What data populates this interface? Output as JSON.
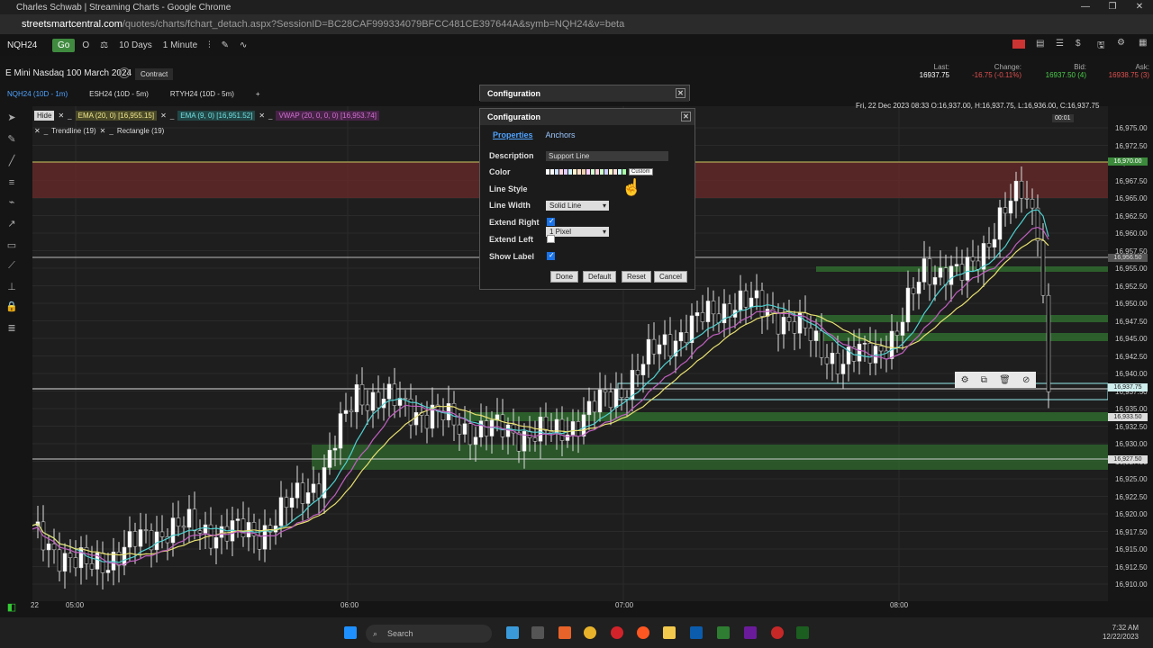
{
  "window": {
    "title": "Charles Schwab | Streaming Charts - Google Chrome",
    "url_host": "streetsmartcentral.com",
    "url_path": "/quotes/charts/fchart_detach.aspx?SessionID=BC28CAF999334079BFCC481CE397644A&symb=NQH24&v=beta"
  },
  "toolbar": {
    "symbol": "NQH24",
    "go": "Go",
    "period": "10 Days",
    "interval": "1 Minute"
  },
  "quote": {
    "name": "E Mini Nasdaq 100 March 2024",
    "contract_label": "Contract",
    "last_label": "Last:",
    "last_value": "16937.75",
    "change_label": "Change:",
    "change_value": "-16.75 (-0.11%)",
    "bid_label": "Bid:",
    "bid_value": "16937.50 (4)",
    "ask_label": "Ask:",
    "ask_value": "16938.75 (3)"
  },
  "tabs": [
    {
      "label": "NQH24 (10D - 1m)"
    },
    {
      "label": "ESH24 (10D - 5m)"
    },
    {
      "label": "RTYH24 (10D - 5m)"
    },
    {
      "label": "+"
    }
  ],
  "indicators": {
    "hide": "Hide",
    "ema20": "EMA (20, 0) [16,955.15]",
    "ema9": "EMA (9, 0) [16,951.52]",
    "vwap": "VWAP (20, 0, 0, 0) [16,953.74]",
    "trendline": "Trendline (19)",
    "rectangle": "Rectangle (19)"
  },
  "chart_header": {
    "datetime": "Fri, 22 Dec 2023 08:33  O:16,937.00, H:16,937.75, L:16,936.00, C:16,937.75",
    "countdown": "00:01"
  },
  "y_ticks": [
    "16,975.00",
    "16,972.50",
    "16,970.00",
    "16,967.50",
    "16,965.00",
    "16,962.50",
    "16,960.00",
    "16,957.50",
    "16,955.00",
    "16,952.50",
    "16,950.00",
    "16,947.50",
    "16,945.00",
    "16,942.50",
    "16,940.00",
    "16,937.50",
    "16,935.00",
    "16,932.50",
    "16,930.00",
    "16,927.50",
    "16,925.00",
    "16,922.50",
    "16,920.00",
    "16,917.50",
    "16,915.00",
    "16,912.50",
    "16,910.00"
  ],
  "price_tags": {
    "tag1": "16,970.00",
    "tag2": "16,956.50",
    "tag3": "16,937.75",
    "tag4": "16,933.50",
    "tag5": "16,927.50"
  },
  "x_ticks": {
    "t0": "22",
    "t1": "05:00",
    "t2": "06:00",
    "t3": "07:00",
    "t4": "08:00"
  },
  "dialog_back": {
    "title": "Configuration"
  },
  "dialog": {
    "title": "Configuration",
    "tab_properties": "Properties",
    "tab_anchors": "Anchors",
    "description_label": "Description",
    "description_value": "Support Line",
    "color_label": "Color",
    "custom_label": "Custom",
    "line_style_label": "Line Style",
    "line_style_value": "Solid Line",
    "line_width_label": "Line Width",
    "line_width_value": "1 Pixel",
    "extend_right_label": "Extend Right",
    "extend_right": true,
    "extend_left_label": "Extend Left",
    "extend_left": false,
    "show_label_label": "Show Label",
    "show_label": true,
    "done": "Done",
    "default": "Default",
    "reset": "Reset",
    "cancel": "Cancel"
  },
  "taskbar": {
    "search": "Search",
    "time": "7:32 AM",
    "date": "12/22/2023"
  }
}
